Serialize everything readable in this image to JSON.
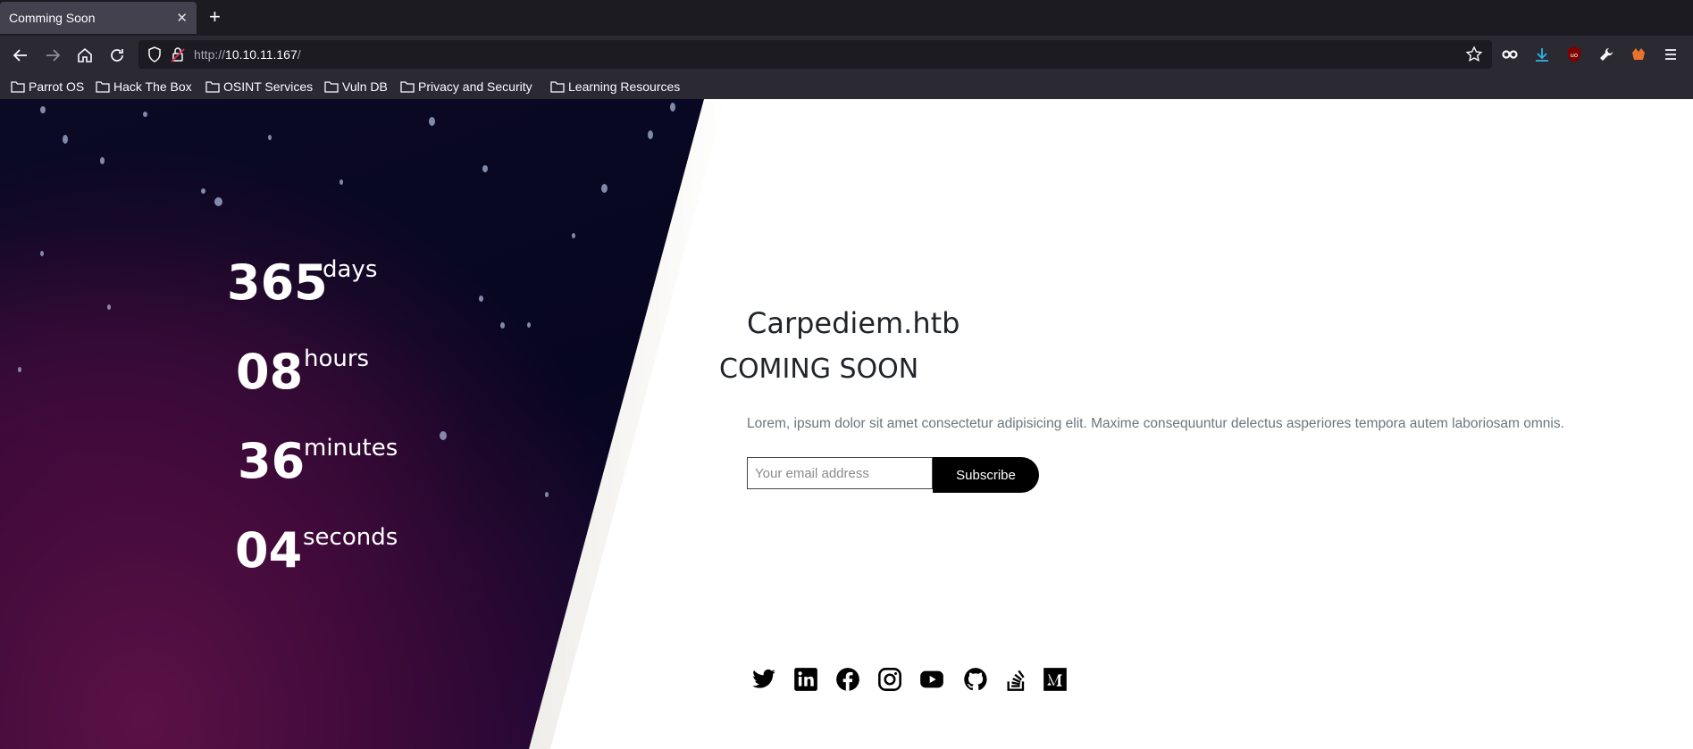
{
  "browser": {
    "tab": {
      "title": "Comming Soon",
      "close": "✕"
    },
    "new_tab": "+",
    "url": {
      "scheme": "http://",
      "host": "10.10.11.167",
      "path": "/"
    },
    "bookmarks": [
      {
        "label": "Parrot OS"
      },
      {
        "label": "Hack The Box"
      },
      {
        "label": "OSINT Services"
      },
      {
        "label": "Vuln DB"
      },
      {
        "label": "Privacy and Security"
      },
      {
        "label": "Learning Resources"
      }
    ]
  },
  "countdown": {
    "days": {
      "value": "365",
      "unit": "days"
    },
    "hours": {
      "value": "08",
      "unit": "hours"
    },
    "minutes": {
      "value": "36",
      "unit": "minutes"
    },
    "seconds": {
      "value": "04",
      "unit": "seconds"
    }
  },
  "main": {
    "site_title": "Carpediem.htb",
    "heading": "COMING SOON",
    "description": "Lorem, ipsum dolor sit amet consectetur adipisicing elit. Maxime consequuntur delectus asperiores tempora autem laboriosam omnis.",
    "email_placeholder": "Your email address",
    "subscribe_label": "Subscribe"
  },
  "social_icons": [
    "twitter-icon",
    "linkedin-icon",
    "facebook-icon",
    "instagram-icon",
    "youtube-icon",
    "github-icon",
    "stackoverflow-icon",
    "medium-icon"
  ],
  "colors": {
    "chrome_dark": "#1c1b22",
    "chrome_toolbar": "#2b2a33",
    "panel_dark": "#070620",
    "panel_purple": "#5b1146",
    "button_black": "#000000"
  }
}
